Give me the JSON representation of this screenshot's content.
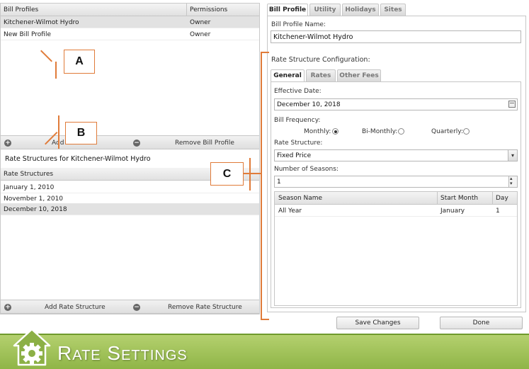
{
  "bill_profiles": {
    "headers": {
      "name": "Bill Profiles",
      "permissions": "Permissions"
    },
    "rows": [
      {
        "name": "Kitchener-Wilmot Hydro",
        "permissions": "Owner"
      },
      {
        "name": "New Bill Profile",
        "permissions": "Owner"
      }
    ],
    "add_label": "Add B",
    "remove_label": "Remove Bill Profile"
  },
  "rate_structures": {
    "section_title": "Rate Structures for Kitchener-Wilmot Hydro",
    "header": "Rate Structures",
    "rows": [
      "January 1, 2010",
      "November 1, 2010",
      "December 10, 2018"
    ],
    "add_label": "Add Rate Structure",
    "remove_label": "Remove Rate Structure"
  },
  "main_tabs": [
    "Bill Profile",
    "Utility",
    "Holidays",
    "Sites"
  ],
  "bill_profile_name": {
    "label": "Bill Profile Name:",
    "value": "Kitchener-Wilmot Hydro"
  },
  "rate_config": {
    "title": "Rate Structure Configuration:",
    "tabs": [
      "General",
      "Rates",
      "Other Fees"
    ],
    "effective_date": {
      "label": "Effective Date:",
      "value": "December 10, 2018"
    },
    "bill_frequency": {
      "label": "Bill Frequency:",
      "options": [
        "Monthly:",
        "Bi-Monthly:",
        "Quarterly:"
      ],
      "selected": "Monthly:"
    },
    "rate_structure": {
      "label": "Rate Structure:",
      "value": "Fixed Price"
    },
    "seasons": {
      "label": "Number of Seasons:",
      "value": "1"
    },
    "season_table": {
      "headers": [
        "Season Name",
        "Start Month",
        "Day"
      ],
      "rows": [
        [
          "All Year",
          "January",
          "1"
        ]
      ]
    }
  },
  "buttons": {
    "save": "Save Changes",
    "done": "Done"
  },
  "callouts": {
    "a": "A",
    "b": "B",
    "c": "C"
  },
  "banner": {
    "title": "Rate Settings"
  },
  "colors": {
    "accent_orange": "#e07b39",
    "banner_green": "#9fc35a"
  }
}
